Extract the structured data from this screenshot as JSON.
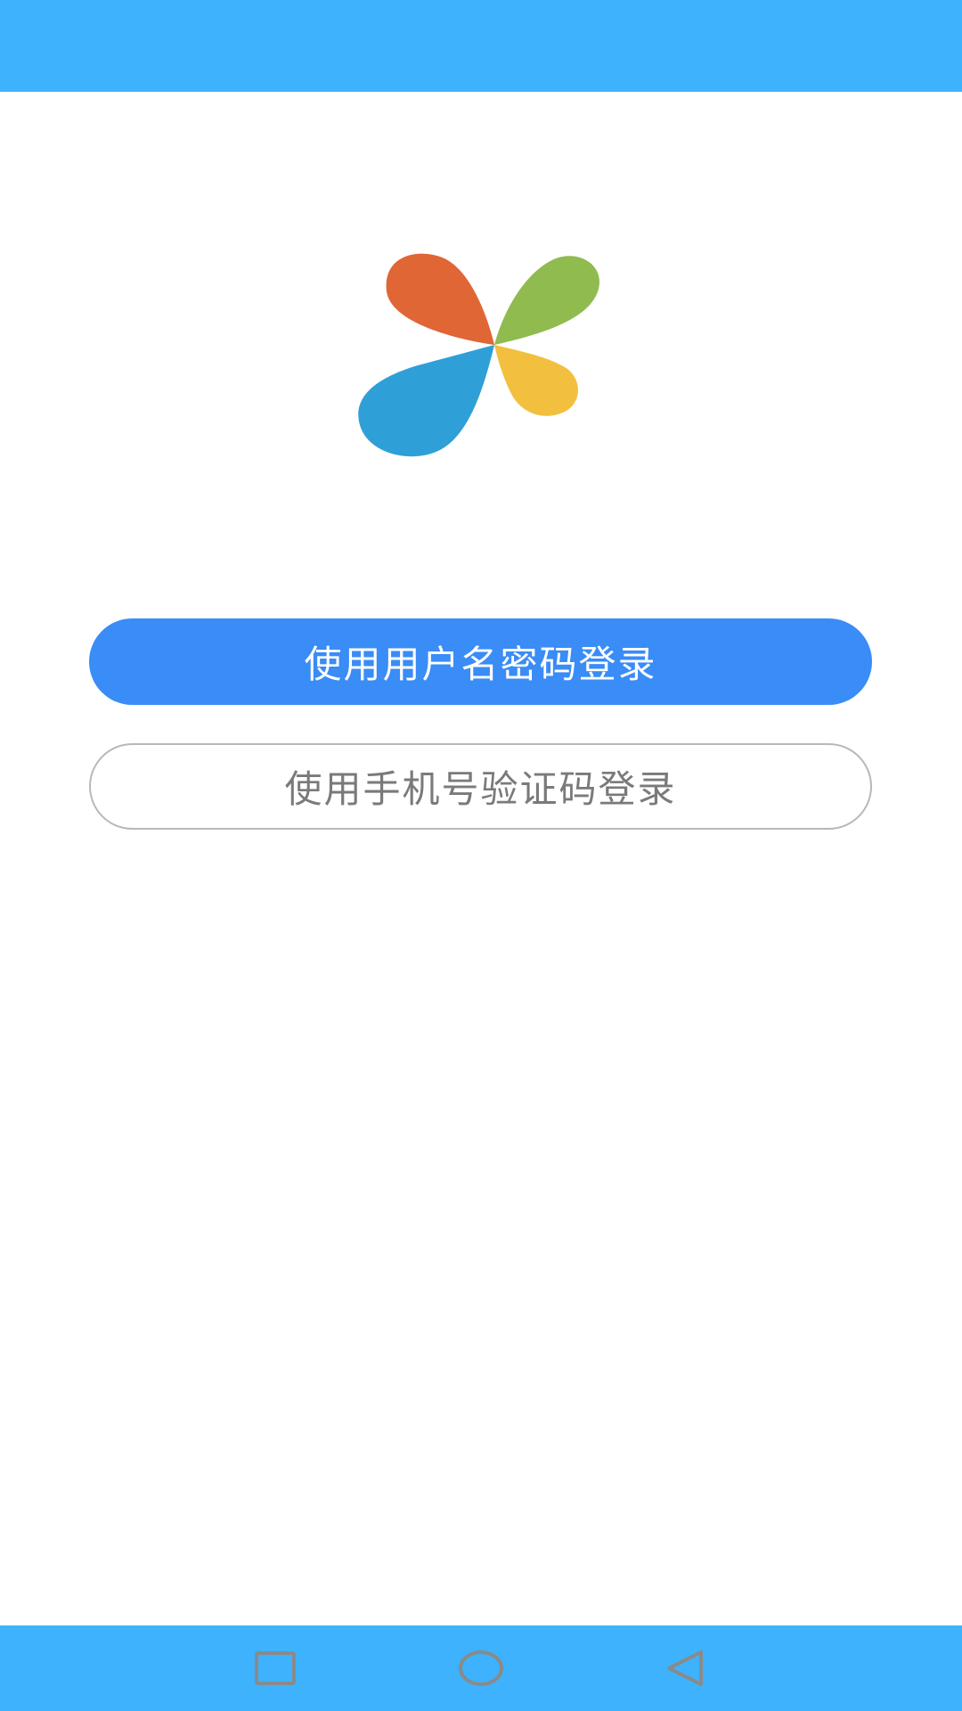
{
  "app": {
    "logo_icon": "four-petal-pinwheel-logo",
    "logo_colors": [
      "#e06636",
      "#8fbb4f",
      "#2f9fd8",
      "#f2c03e"
    ]
  },
  "login": {
    "username_password_label": "使用用户名密码登录",
    "sms_code_label": "使用手机号验证码登录"
  },
  "colors": {
    "status_bar": "#3eb2fd",
    "primary_button": "#3a8cf6",
    "nav_bar": "#3eb2fd"
  },
  "nav": {
    "recent_icon": "square-icon",
    "home_icon": "circle-icon",
    "back_icon": "triangle-back-icon"
  }
}
